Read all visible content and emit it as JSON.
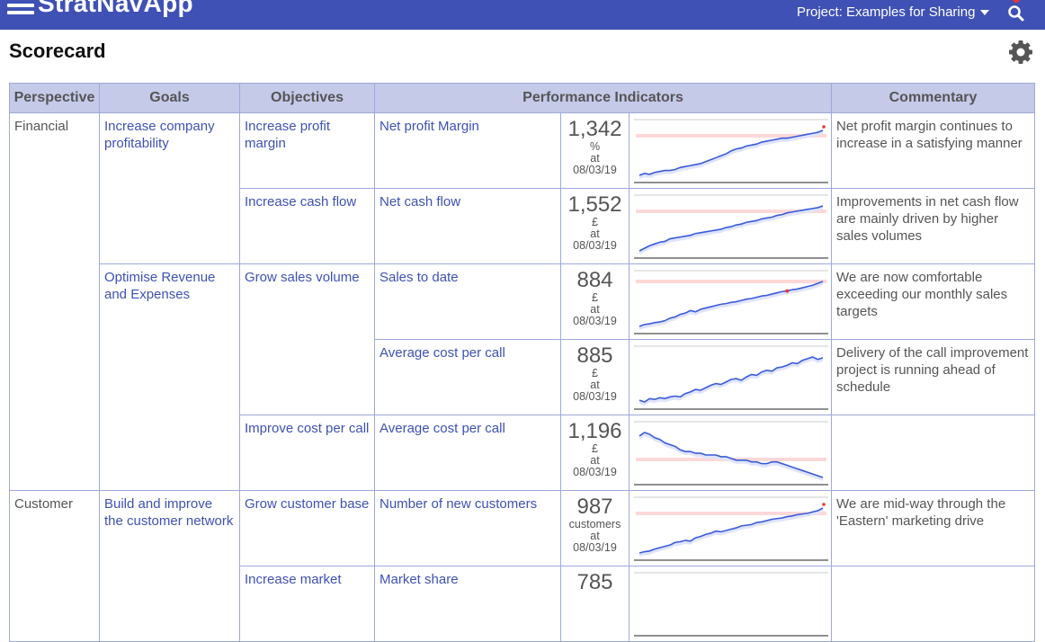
{
  "header": {
    "app_name": "StratNavApp",
    "project_label": "Project: Examples for Sharing"
  },
  "page": {
    "title": "Scorecard"
  },
  "table": {
    "columns": [
      "Perspective",
      "Goals",
      "Objectives",
      "Performance Indicators",
      "Commentary"
    ],
    "perspectives": [
      "Financial",
      "Customer"
    ],
    "goals": [
      "Increase company profitability",
      "Optimise Revenue and Expenses",
      "Build and improve the customer network"
    ],
    "objectives": [
      "Increase profit margin",
      "Increase cash flow",
      "Grow sales volume",
      "Improve cost per call",
      "Grow customer base",
      "Increase market"
    ],
    "indicators": [
      {
        "name": "Net profit Margin",
        "value": "1,342",
        "unit": "%",
        "at": "at",
        "date": "08/03/19",
        "commentary": "Net profit margin continues to increase in a satisfying manner",
        "trend": [
          10,
          12,
          11,
          13,
          14,
          15,
          15,
          16,
          18,
          19,
          20,
          21,
          22,
          24,
          26,
          28,
          30,
          32,
          35,
          37,
          38,
          40,
          41,
          42,
          44,
          45,
          46,
          47,
          48,
          48,
          49,
          50,
          51,
          52,
          53,
          54,
          56
        ]
      },
      {
        "name": "Net cash flow",
        "value": "1,552",
        "unit": "£",
        "at": "at",
        "date": "08/03/19",
        "commentary": "Improvements in net cash flow are mainly driven by higher sales volumes",
        "trend": [
          10,
          13,
          16,
          18,
          20,
          21,
          24,
          25,
          26,
          27,
          28,
          30,
          31,
          32,
          33,
          34,
          35,
          37,
          38,
          40,
          41,
          43,
          44,
          45,
          47,
          48,
          49,
          51,
          52,
          54,
          55,
          56,
          57,
          58,
          59,
          60,
          62
        ]
      },
      {
        "name": "Sales to date",
        "value": "884",
        "unit": "£",
        "at": "at",
        "date": "08/03/19",
        "commentary": "We are now comfortable exceeding our monthly sales targets",
        "trend": [
          5,
          8,
          9,
          11,
          12,
          14,
          18,
          20,
          24,
          26,
          30,
          28,
          32,
          34,
          36,
          38,
          40,
          41,
          43,
          44,
          46,
          48,
          49,
          51,
          53,
          54,
          56,
          58,
          60,
          61,
          63,
          64,
          66,
          68,
          70,
          73,
          76
        ]
      },
      {
        "name": "Average cost per call",
        "value": "885",
        "unit": "£",
        "at": "at",
        "date": "08/03/19",
        "commentary": "Delivery of the call improvement project is running ahead of schedule",
        "trend": [
          20,
          18,
          22,
          21,
          23,
          22,
          24,
          25,
          24,
          28,
          30,
          33,
          32,
          35,
          38,
          40,
          39,
          42,
          45,
          46,
          44,
          48,
          51,
          50,
          54,
          56,
          55,
          59,
          60,
          62,
          65,
          64,
          68,
          70,
          72,
          69,
          71
        ]
      },
      {
        "name": "Average cost per call",
        "value": "1,196",
        "unit": "£",
        "at": "at",
        "date": "08/03/19",
        "commentary": "",
        "trend": [
          60,
          62,
          61,
          59,
          58,
          56,
          55,
          54,
          52,
          51,
          51,
          50,
          50,
          49,
          49,
          49,
          48,
          48,
          47,
          46,
          46,
          46,
          45,
          45,
          44,
          44,
          45,
          45,
          44,
          43,
          42,
          41,
          40,
          39,
          38,
          37,
          36
        ]
      },
      {
        "name": "Number of new customers",
        "value": "987",
        "unit": "customers",
        "at": "at",
        "date": "08/03/19",
        "commentary": "We are mid-way through the 'Eastern' marketing drive",
        "trend": [
          10,
          12,
          13,
          16,
          18,
          20,
          22,
          26,
          27,
          29,
          28,
          33,
          35,
          38,
          40,
          43,
          42,
          44,
          46,
          48,
          51,
          52,
          53,
          56,
          57,
          59,
          61,
          62,
          63,
          65,
          66,
          68,
          69,
          70,
          72,
          74,
          78
        ]
      },
      {
        "name": "Market share",
        "value": "785",
        "unit": "",
        "at": "",
        "date": "",
        "commentary": "",
        "trend": []
      }
    ]
  },
  "colors": {
    "header_bg": "#3f51b5",
    "th_bg": "#c5cae9",
    "link": "#3f51b5",
    "line": "#3a5bd9",
    "target": "#fdd8d8",
    "flag": "#e53935"
  }
}
